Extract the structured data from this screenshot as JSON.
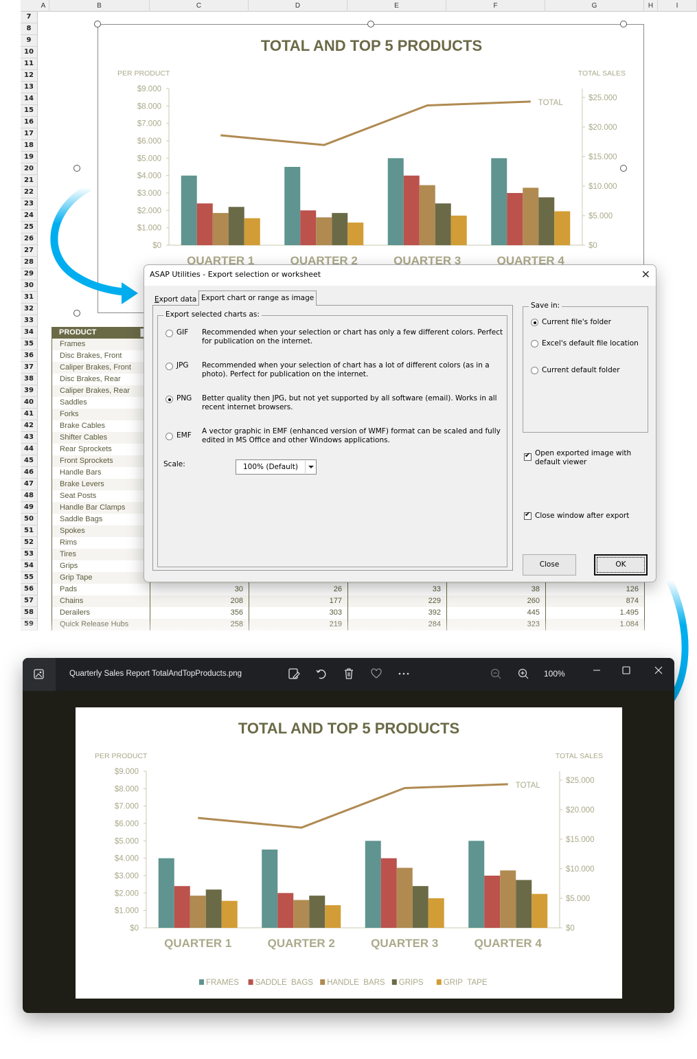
{
  "sheet": {
    "columns": [
      "A",
      "B",
      "C",
      "D",
      "E",
      "F",
      "G",
      "H",
      "I"
    ],
    "rows": [
      "7",
      "8",
      "9",
      "10",
      "11",
      "12",
      "13",
      "14",
      "15",
      "16",
      "17",
      "18",
      "19",
      "20",
      "21",
      "22",
      "23",
      "24",
      "25",
      "26",
      "27",
      "28",
      "29",
      "30",
      "31",
      "32",
      "33",
      "34",
      "35",
      "36",
      "37",
      "38",
      "39",
      "40",
      "41",
      "42",
      "43",
      "44",
      "45",
      "46",
      "47",
      "48",
      "49",
      "50",
      "51",
      "52",
      "53",
      "54",
      "55",
      "56",
      "57",
      "58",
      "59"
    ],
    "table": {
      "header": "PRODUCT",
      "rows": [
        {
          "name": "Frames",
          "values": []
        },
        {
          "name": "Disc Brakes, Front",
          "values": []
        },
        {
          "name": "Caliper Brakes, Front",
          "values": []
        },
        {
          "name": "Disc Brakes, Rear",
          "values": []
        },
        {
          "name": "Caliper Brakes, Rear",
          "values": []
        },
        {
          "name": "Saddles",
          "values": []
        },
        {
          "name": "Forks",
          "values": []
        },
        {
          "name": "Brake Cables",
          "values": []
        },
        {
          "name": "Shifter Cables",
          "values": []
        },
        {
          "name": "Rear Sprockets",
          "values": []
        },
        {
          "name": "Front Sprockets",
          "values": []
        },
        {
          "name": "Handle Bars",
          "values": []
        },
        {
          "name": "Brake Levers",
          "values": []
        },
        {
          "name": "Seat Posts",
          "values": []
        },
        {
          "name": "Handle Bar Clamps",
          "values": []
        },
        {
          "name": "Saddle Bags",
          "values": []
        },
        {
          "name": "Spokes",
          "values": []
        },
        {
          "name": "Rims",
          "values": []
        },
        {
          "name": "Tires",
          "values": []
        },
        {
          "name": "Grips",
          "values": []
        },
        {
          "name": "Grip Tape",
          "values": []
        },
        {
          "name": "Pads",
          "values": [
            "30",
            "26",
            "33",
            "38",
            "126"
          ]
        },
        {
          "name": "Chains",
          "values": [
            "208",
            "177",
            "229",
            "260",
            "874"
          ]
        },
        {
          "name": "Derailers",
          "values": [
            "356",
            "303",
            "392",
            "445",
            "1.495"
          ]
        },
        {
          "name": "Quick Release Hubs",
          "values": [
            "258",
            "219",
            "284",
            "323",
            "1.084"
          ]
        }
      ]
    }
  },
  "dialog": {
    "title": "ASAP Utilities - Export selection or worksheet",
    "tabs": [
      {
        "label": "Export data",
        "active": false
      },
      {
        "label": "Export chart or range as image",
        "active": true
      }
    ],
    "format_group_label": "Export selected charts as:",
    "formats": [
      {
        "code": "GIF",
        "selected": false,
        "description": "Recommended when your selection or chart has only a few different colors. Perfect for publication on the internet."
      },
      {
        "code": "JPG",
        "selected": false,
        "description": "Recommended when your selection of chart has a lot of different colors (as in a photo). Perfect for publication on the internet."
      },
      {
        "code": "PNG",
        "selected": true,
        "description": "Better quality then JPG, but not yet supported by all software (email). Works in all recent internet browsers."
      },
      {
        "code": "EMF",
        "selected": false,
        "description": "A vector graphic in EMF (enhanced version of WMF) format can be scaled and fully edited in MS Office and other Windows applications."
      }
    ],
    "scale_label": "Scale:",
    "scale_value": "100% (Default)",
    "save_group_label": "Save in:",
    "save_options": [
      {
        "label": "Current file's folder",
        "selected": true
      },
      {
        "label": "Excel's default file location",
        "selected": false
      },
      {
        "label": "Current default folder",
        "selected": false
      }
    ],
    "open_viewer_label": "Open exported image with default viewer",
    "open_viewer_checked": true,
    "close_after_label": "Close window after export",
    "close_after_checked": true,
    "close_button": "Close",
    "ok_button": "OK"
  },
  "viewer": {
    "filename": "Quarterly Sales Report TotalAndTopProducts.png",
    "zoom": "100%"
  },
  "chart_data": {
    "type": "bar",
    "title": "TOTAL AND TOP 5 PRODUCTS",
    "ylabel": "PER PRODUCT",
    "y2label": "TOTAL SALES",
    "categories": [
      "QUARTER 1",
      "QUARTER 2",
      "QUARTER 3",
      "QUARTER 4"
    ],
    "ylim": [
      0,
      9000
    ],
    "yticks": [
      "$0",
      "$1.000",
      "$2.000",
      "$3.000",
      "$4.000",
      "$5.000",
      "$6.000",
      "$7.000",
      "$8.000",
      "$9.000"
    ],
    "y2lim": [
      0,
      26500
    ],
    "y2ticks": [
      "$0",
      "$5.000",
      "$10.000",
      "$15.000",
      "$20.000",
      "$25.000"
    ],
    "series": [
      {
        "name": "FRAMES",
        "color": "#5f9490",
        "values": [
          4000,
          4500,
          5000,
          5000
        ]
      },
      {
        "name": "SADDLE BAGS",
        "color": "#bb524c",
        "values": [
          2400,
          2000,
          4000,
          3000
        ]
      },
      {
        "name": "HANDLE BARS",
        "color": "#b08a51",
        "values": [
          1850,
          1600,
          3450,
          3300
        ]
      },
      {
        "name": "GRIPS",
        "color": "#6b6a47",
        "values": [
          2200,
          1850,
          2400,
          2750
        ]
      },
      {
        "name": "GRIP TAPE",
        "color": "#d29d36",
        "values": [
          1550,
          1300,
          1700,
          1950
        ]
      }
    ],
    "line_series": {
      "name": "TOTAL",
      "color": "#b08a51",
      "axis": "secondary",
      "values": [
        18600,
        16950,
        23650,
        24300
      ]
    },
    "legend": "bottom",
    "grid": false
  }
}
